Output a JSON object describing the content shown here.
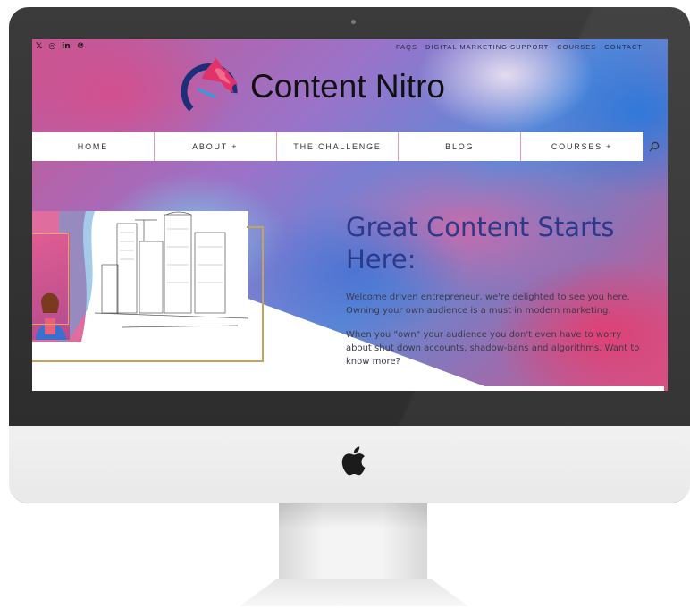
{
  "site": {
    "brand": "Content Nitro",
    "social_icons": [
      {
        "name": "twitter-icon",
        "glyph": "𝕏"
      },
      {
        "name": "instagram-icon",
        "glyph": "◎"
      },
      {
        "name": "linkedin-icon",
        "glyph": "in"
      },
      {
        "name": "pinterest-icon",
        "glyph": "℗"
      }
    ],
    "top_nav": [
      "FAQS",
      "DIGITAL MARKETING SUPPORT",
      "COURSES",
      "CONTACT"
    ],
    "main_nav": [
      "HOME",
      "ABOUT +",
      "THE CHALLENGE",
      "BLOG",
      "COURSES +"
    ],
    "hero": {
      "title": "Great Content Starts Here:",
      "paragraph1": "Welcome driven entrepreneur, we're delighted to see you here. Owning your own audience is a must in modern marketing.",
      "paragraph2": "When you \"own\" your audience you don't even have to worry about shut down accounts, shadow-bans and algorithms. Want to know more?"
    }
  },
  "colors": {
    "title": "#2b3a8a",
    "nav_divider": "#e89bbb",
    "frame_gold": "#c7a35a",
    "bezel": "#2d2d2d"
  }
}
